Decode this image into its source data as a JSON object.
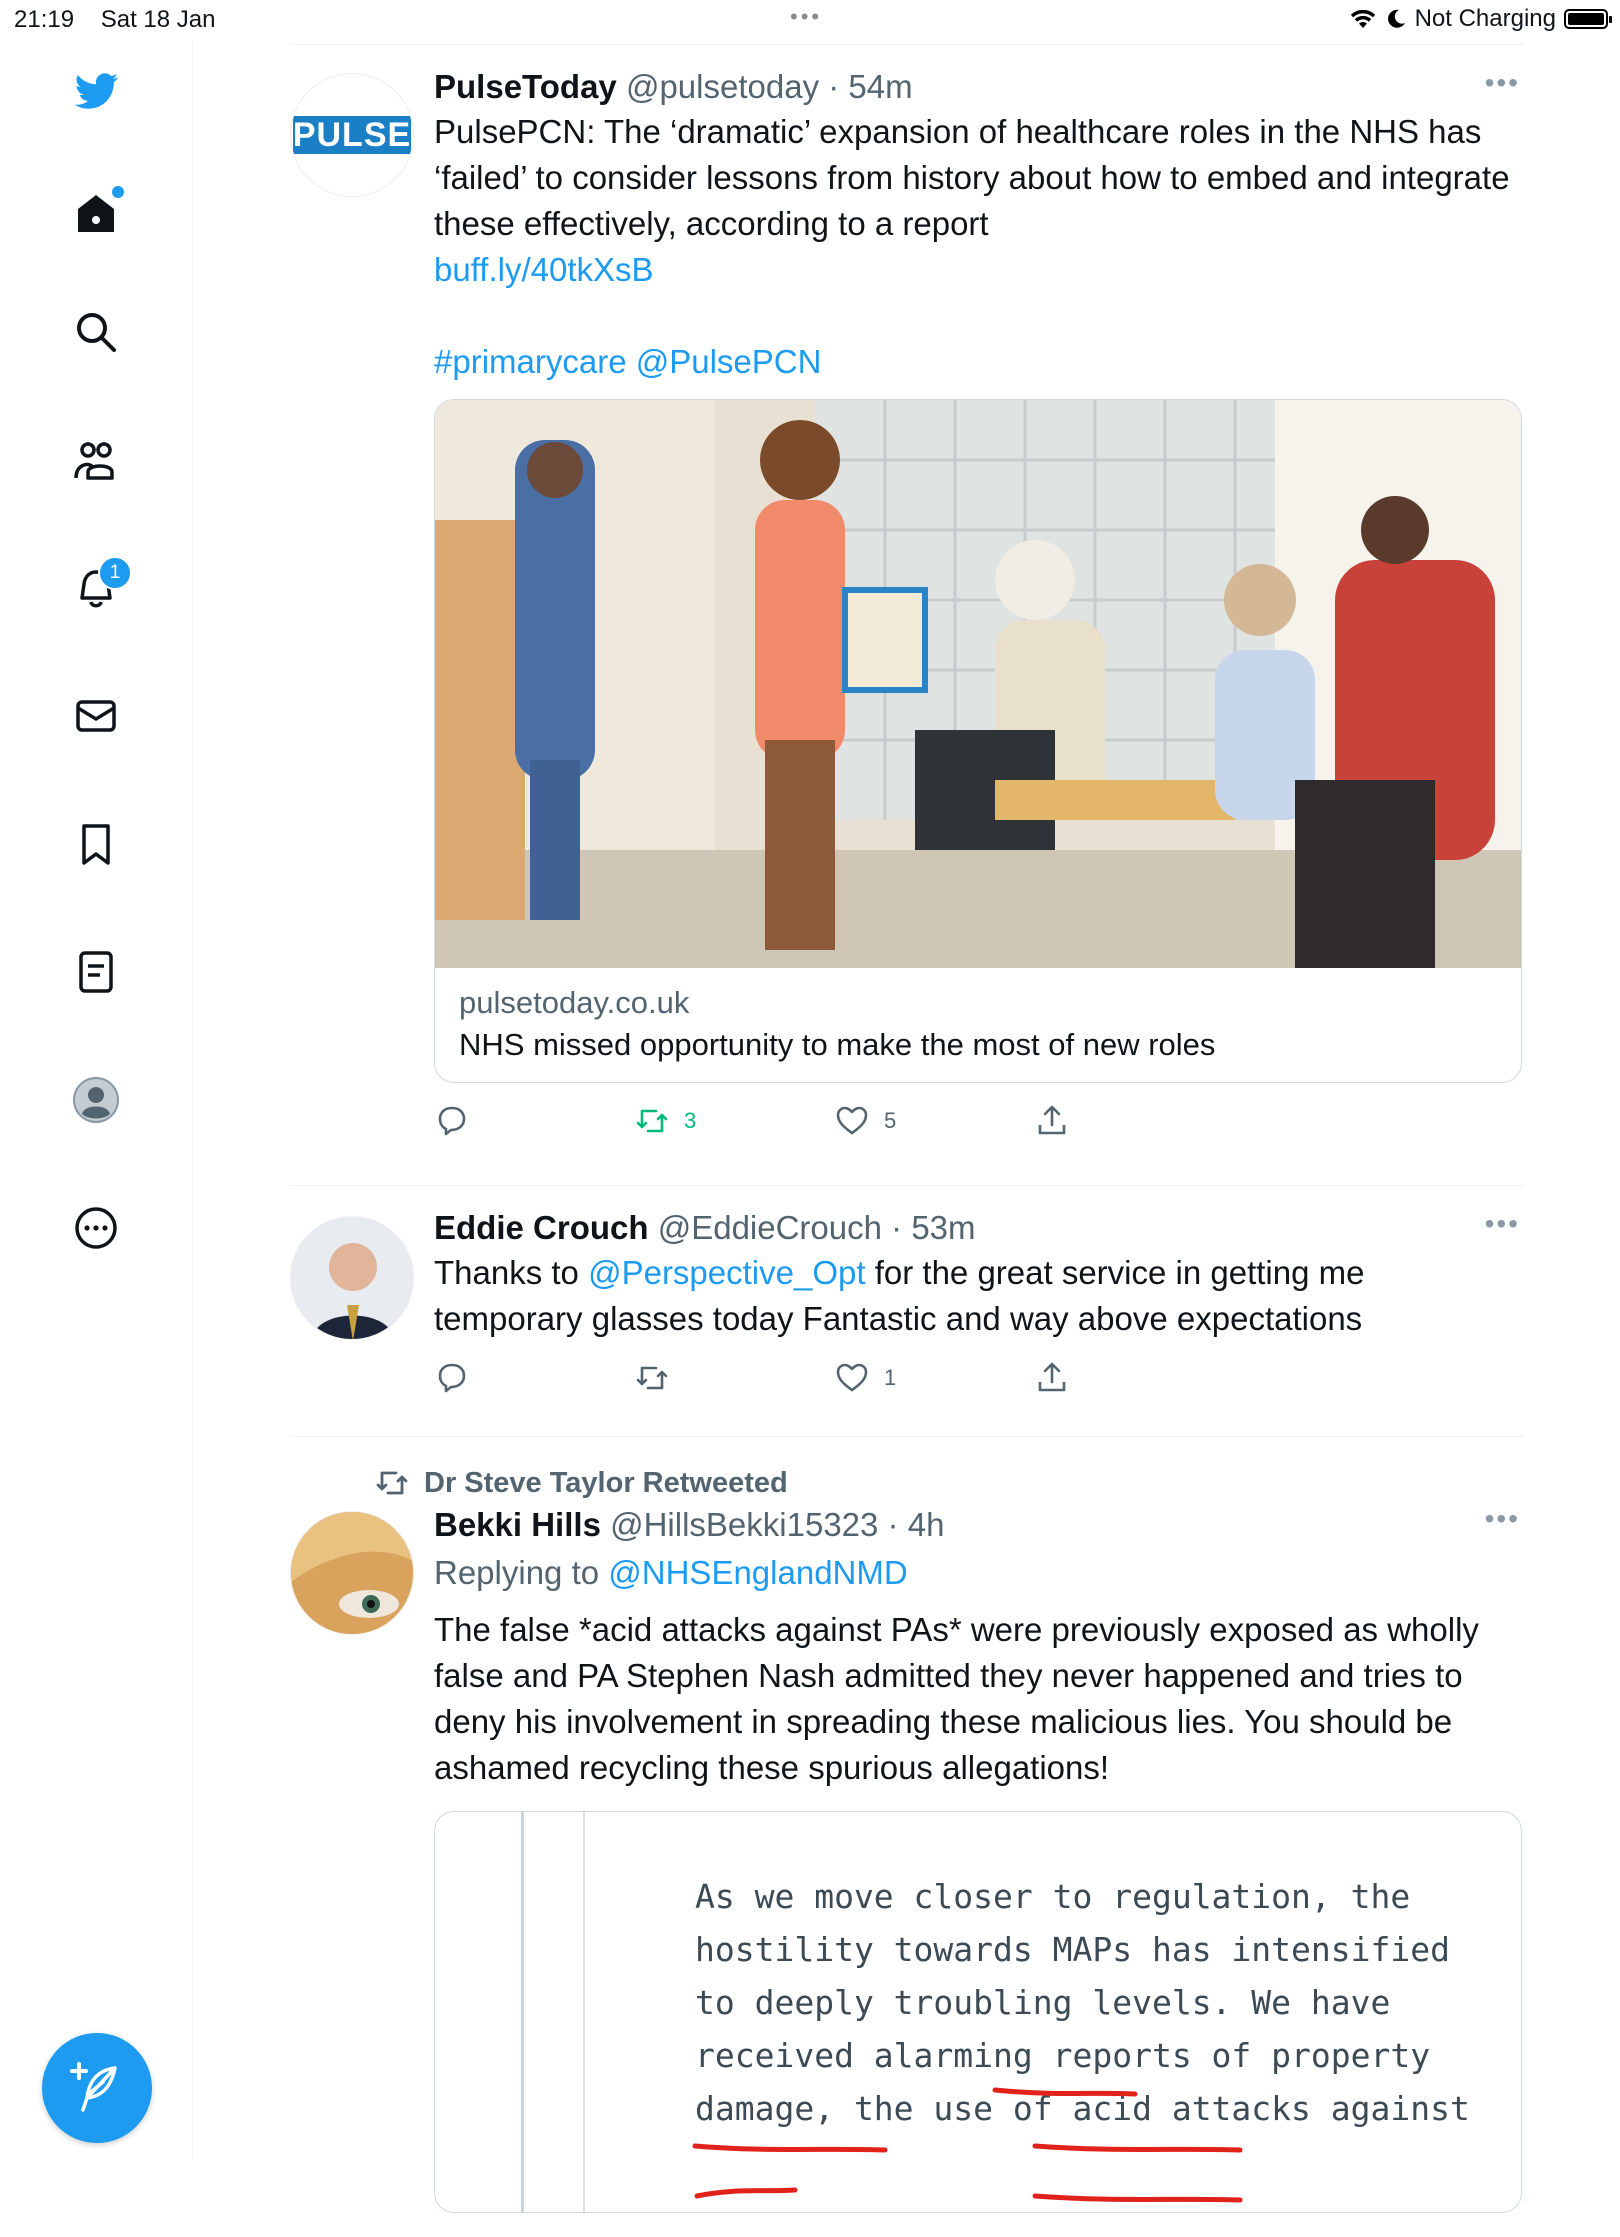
{
  "status_bar": {
    "time": "21:19",
    "date": "Sat 18 Jan",
    "charging": "Not Charging"
  },
  "sidebar": {
    "notifications_badge": "1",
    "items": [
      {
        "icon": "twitter-bird-icon"
      },
      {
        "icon": "home-icon"
      },
      {
        "icon": "search-icon"
      },
      {
        "icon": "communities-icon"
      },
      {
        "icon": "notifications-bell-icon"
      },
      {
        "icon": "messages-icon"
      },
      {
        "icon": "bookmarks-icon"
      },
      {
        "icon": "lists-icon"
      },
      {
        "icon": "profile-icon"
      },
      {
        "icon": "more-options-icon"
      }
    ],
    "compose_icon": "compose-tweet-icon"
  },
  "tweets": [
    {
      "name": "PulseToday",
      "handle": "@pulsetoday",
      "time": "54m",
      "avatar_text": "PULSE",
      "text": "PulsePCN: The ‘dramatic’ expansion of healthcare roles in the NHS has ‘failed’ to consider lessons from history about how to embed and integrate these effectively, according to a report",
      "link": "buff.ly/40tkXsB",
      "hashtag": "#primarycare",
      "mention": "@PulsePCN",
      "card": {
        "domain": "pulsetoday.co.uk",
        "title": "NHS missed opportunity to make the most of new roles"
      },
      "retweets": "3",
      "likes": "5"
    },
    {
      "name": "Eddie Crouch",
      "handle": "@EddieCrouch",
      "time": "53m",
      "text_before": "Thanks to ",
      "mention": "@Perspective_Opt",
      "text_after": " for the great service in getting me temporary glasses today Fantastic and way above expectations",
      "likes": "1"
    },
    {
      "social_context": "Dr Steve Taylor Retweeted",
      "name": "Bekki Hills",
      "handle": "@HillsBekki15323",
      "time": "4h",
      "replying_label": "Replying to ",
      "replying_to": "@NHSEnglandNMD",
      "text": "The false *acid attacks against PAs* were previously exposed as wholly false and PA Stephen Nash admitted they never happened and tries to deny his involvement in spreading these malicious lies. You should be ashamed recycling these spurious allegations!",
      "image_lines": [
        "As we move closer to regulation, the",
        "hostility towards MAPs has intensified",
        "to deeply troubling levels. We have",
        "received alarming reports of property",
        "damage, the use of acid attacks against"
      ]
    }
  ],
  "colors": {
    "accent": "#1d9bf0",
    "retweet_green": "#00ba7c",
    "secondary_text": "#536471",
    "underline_red": "#e0221b"
  }
}
